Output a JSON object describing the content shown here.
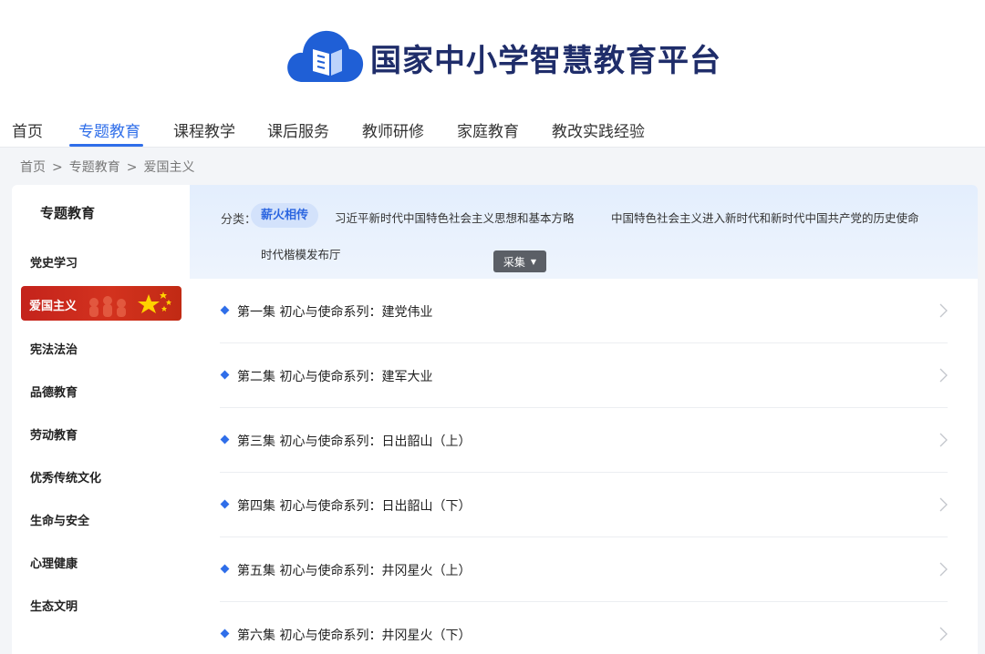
{
  "header": {
    "logo_text": "国家中小学智慧教育平台",
    "brand_color": "#1f5fd6"
  },
  "nav": {
    "items": [
      {
        "label": "首页",
        "active": false
      },
      {
        "label": "专题教育",
        "active": true
      },
      {
        "label": "课程教学",
        "active": false
      },
      {
        "label": "课后服务",
        "active": false
      },
      {
        "label": "教师研修",
        "active": false
      },
      {
        "label": "家庭教育",
        "active": false
      },
      {
        "label": "教改实践经验",
        "active": false
      }
    ],
    "active_color": "#2f6ee9"
  },
  "breadcrumb": [
    "首页",
    "专题教育",
    "爱国主义"
  ],
  "sidebar": {
    "title": "专题教育",
    "items": [
      {
        "label": "党史学习",
        "active": false
      },
      {
        "label": "爱国主义",
        "active": true
      },
      {
        "label": "宪法法治",
        "active": false
      },
      {
        "label": "品德教育",
        "active": false
      },
      {
        "label": "劳动教育",
        "active": false
      },
      {
        "label": "优秀传统文化",
        "active": false
      },
      {
        "label": "生命与安全",
        "active": false
      },
      {
        "label": "心理健康",
        "active": false
      },
      {
        "label": "生态文明",
        "active": false
      }
    ]
  },
  "filter": {
    "label": "分类：",
    "selected": "薪火相传",
    "categories": [
      "习近平新时代中国特色社会主义思想和基本方略",
      "中国特色社会主义进入新时代和新时代中国共产党的历史使命",
      "时代楷模发布厅"
    ]
  },
  "collect_button": "采集",
  "episodes": [
    "第一集 初心与使命系列：建党伟业",
    "第二集 初心与使命系列：建军大业",
    "第三集 初心与使命系列：日出韶山（上）",
    "第四集 初心与使命系列：日出韶山（下）",
    "第五集 初心与使命系列：井冈星火（上）",
    "第六集 初心与使命系列：井冈星火（下）"
  ],
  "icons": {
    "logo": "cloud-book-logo-icon",
    "list_marker": "diamond-icon",
    "row_arrow": "chevron-right-icon",
    "dropdown": "caret-down-icon",
    "active_decoration": "star-flag-icon"
  }
}
